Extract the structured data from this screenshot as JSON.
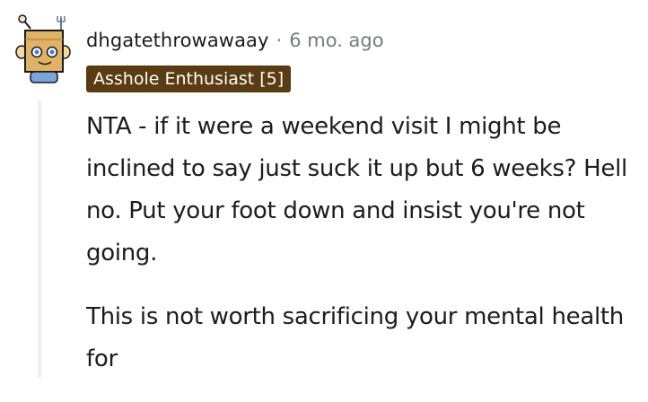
{
  "comment": {
    "author": "dhgatethrowawaay",
    "separator": "·",
    "timestamp": "6 mo. ago",
    "flair": "Asshole Enthusiast [5]",
    "flair_color": "#5b3b12",
    "avatar_icon": "snoo-box-avatar-icon",
    "paragraphs": [
      "NTA - if it were a weekend visit I might be inclined to say just suck it up but 6 weeks? Hell no. Put your foot down and insist you're not going.",
      "This is not worth sacrificing your mental health for"
    ]
  }
}
